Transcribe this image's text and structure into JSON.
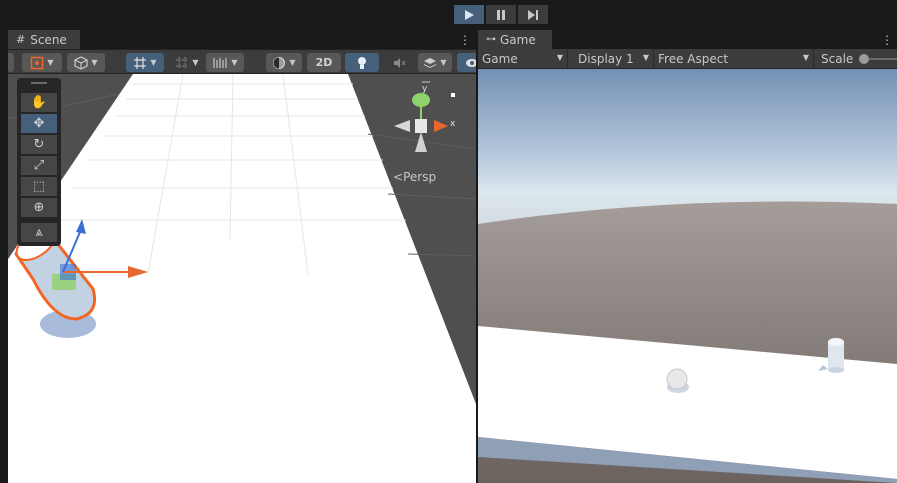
{
  "playbar": {
    "play_icon": "play-icon",
    "pause_icon": "pause-icon",
    "step_icon": "step-icon",
    "play_active": true
  },
  "scene": {
    "tab_label": "Scene",
    "tab_icon": "grid-icon",
    "toolbar": {
      "twod_label": "2D"
    },
    "tools": [
      "hand-tool-icon",
      "move-tool-icon",
      "rotate-tool-icon",
      "scale-tool-icon",
      "rect-tool-icon",
      "transform-tool-icon",
      "custom-tool-icon"
    ],
    "selected_tool": "move-tool-icon",
    "gizmo": {
      "y_label": "y",
      "x_label": "x",
      "projection_label": "Persp"
    }
  },
  "game": {
    "tab_label": "Game",
    "tab_icon": "gamepad-icon",
    "toolbar": {
      "view_mode": "Game",
      "display": "Display 1",
      "aspect": "Free Aspect",
      "scale_label": "Scale"
    }
  },
  "colors": {
    "accent_blue": "#46607c",
    "selection_orange": "#f26522",
    "axis_red": "#e8672f",
    "axis_green": "#8fd16a",
    "axis_blue": "#3a6fd8"
  }
}
